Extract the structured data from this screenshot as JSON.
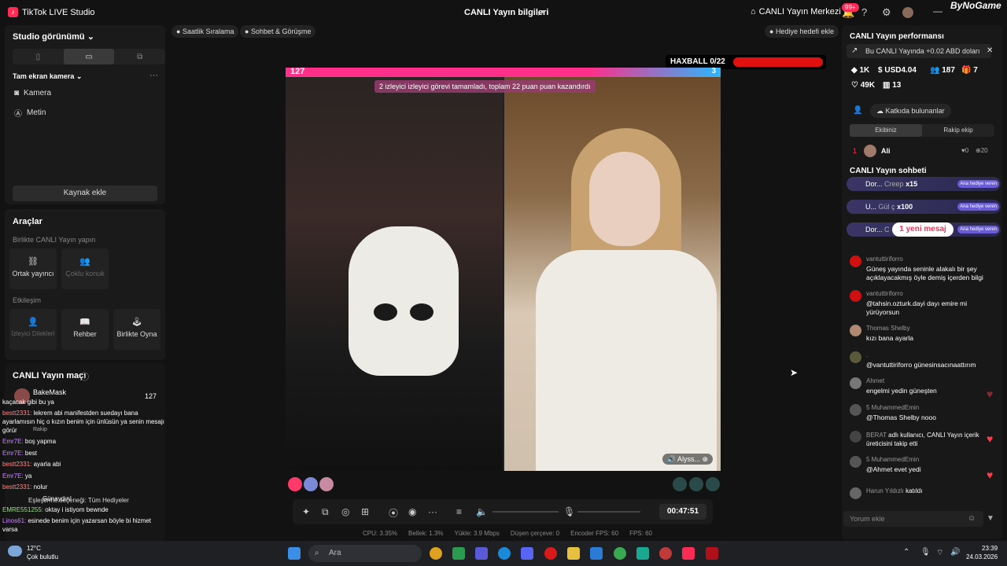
{
  "titlebar": {
    "app_name": "TikTok LIVE Studio",
    "center_title": "CANLI Yayın bilgileri",
    "live_center": "CANLI Yayın Merkezi",
    "notif_count": "99+",
    "brand": "ByNoGame"
  },
  "left": {
    "studio_view": "Studio görünümü",
    "fullscreen_camera": "Tam ekran kamera",
    "sources": [
      "Kamera",
      "Metin"
    ],
    "add_source": "Kaynak ekle",
    "tools_title": "Araçlar",
    "coop_title": "Birlikte CANLI Yayın yapın",
    "coop_tools": [
      "Ortak yayıncı",
      "Çoklu konuk"
    ],
    "interaction_title": "Etkileşim",
    "interaction_tools": [
      "İzleyici Dilekleri",
      "Rehber",
      "Birlikte Oyna"
    ],
    "match_title": "CANLI Yayın maçı",
    "opponent_name": "BakeMask",
    "opponent_score": "127",
    "overlay_matching": "Eşleştirme seçeneği: Tüm Hediyeler",
    "overlay_rakip": "Rakip",
    "chat": [
      {
        "user": "",
        "text": "kaçacak gibi bu ya"
      },
      {
        "user": "bestt2331:",
        "text": "lekrem abi manifestden suedayı bana"
      },
      {
        "user": "",
        "text": "ayarlamısın hiç o kızın benim için ünlüsün ya senin mesajı"
      },
      {
        "user": "",
        "text": "görür"
      },
      {
        "user": "Emr7E:",
        "text": "boş yapma"
      },
      {
        "user": "Emr7E:",
        "text": "best"
      },
      {
        "user": "bestt2331:",
        "text": "ayarla abi"
      },
      {
        "user": "Emr7E:",
        "text": "ya"
      },
      {
        "user": "bestt2331:",
        "text": "nolur"
      },
      {
        "user": "",
        "text": "Günaydın!"
      },
      {
        "user": "EMRE551255:",
        "text": "oktay i istiyom bewnde"
      },
      {
        "user": "Linos61:",
        "text": "esinede benim için yazarsan böyle bi hizmet"
      },
      {
        "user": "",
        "text": "varsa"
      }
    ]
  },
  "center": {
    "chip_hourly": "Saatlik Sıralama",
    "chip_chat": "Sohbet & Görüşme",
    "goal_chip": "Hediye hedefi ekle",
    "haxball": "HAXBALL 0/22",
    "score_left": "127",
    "score_right": "3",
    "banner": "2 izleyici izleyici görevi tamamladı, toplam 22 puan puan kazandırdı",
    "guest_name": "Alyss...",
    "timer": "00:47:51",
    "stats": [
      "CPU: 3.35%",
      "Bellek: 1.3%",
      "Yükle: 3.9 Mbps",
      "Düşen çerçeve: 0",
      "Encoder FPS: 60",
      "FPS: 60"
    ]
  },
  "right": {
    "perf_title": "CANLI Yayın performansı",
    "earn_text": "Bu CANLI Yayında +0.02 ABD doları",
    "stats": [
      "1K",
      "USD4.04",
      "187",
      "7",
      "49K",
      "13"
    ],
    "contributors": "Katkıda bulunanlar",
    "tab_team": "Ekibiniz",
    "tab_rival": "Rakip ekip",
    "top_rank": "1",
    "top_user": "Ali",
    "top_likes": "0",
    "top_gifts": "20",
    "chat_title": "CANLI Yayın sohbeti",
    "gift_rows": [
      {
        "user": "Dor...",
        "gift": "Creep",
        "count": "x15",
        "tag": "Ana hediye veren"
      },
      {
        "user": "U...",
        "gift": "Gül ç",
        "count": "x100",
        "tag": "Ana hediye veren"
      },
      {
        "user": "Dor...",
        "gift": "C",
        "count": "",
        "tag": "Ana hediye veren"
      }
    ],
    "new_message": "1 yeni mesaj",
    "messages": [
      {
        "name": "vantuttiriforro",
        "text": "Güneş yayında seninle alakalı bir şey açıklayacakmış öyle demiş içerden bilgi"
      },
      {
        "name": "vantuttiriforro",
        "text": "@tahsin.ozturk.dayi dayı emire mi yürüyorsun"
      },
      {
        "name": "Thomas Shelby",
        "text": "kızı bana ayarla"
      },
      {
        "name": ".",
        "text": "@vantuttiriforro günesinsacınaattırım"
      },
      {
        "name": "Ahmet",
        "text": "engelmi yedin güneşten"
      },
      {
        "name": "5 MuhammedEmin",
        "text": "@Thomas Shelby nooo"
      },
      {
        "name": "BERAT",
        "text": "adlı kullanıcı, CANLI Yayın içerik üreticisini takip etti"
      },
      {
        "name": "5 MuhammedEmin",
        "text": "@Ahmet evet yedi"
      },
      {
        "name": "Harun Yıldızlı",
        "text": "katıldı"
      }
    ],
    "comment_placeholder": "Yorum ekle"
  },
  "taskbar": {
    "temp": "12°C",
    "weather": "Çok bulutlu",
    "search": "Ara",
    "time": "23:39",
    "date": "24.03.2026"
  }
}
